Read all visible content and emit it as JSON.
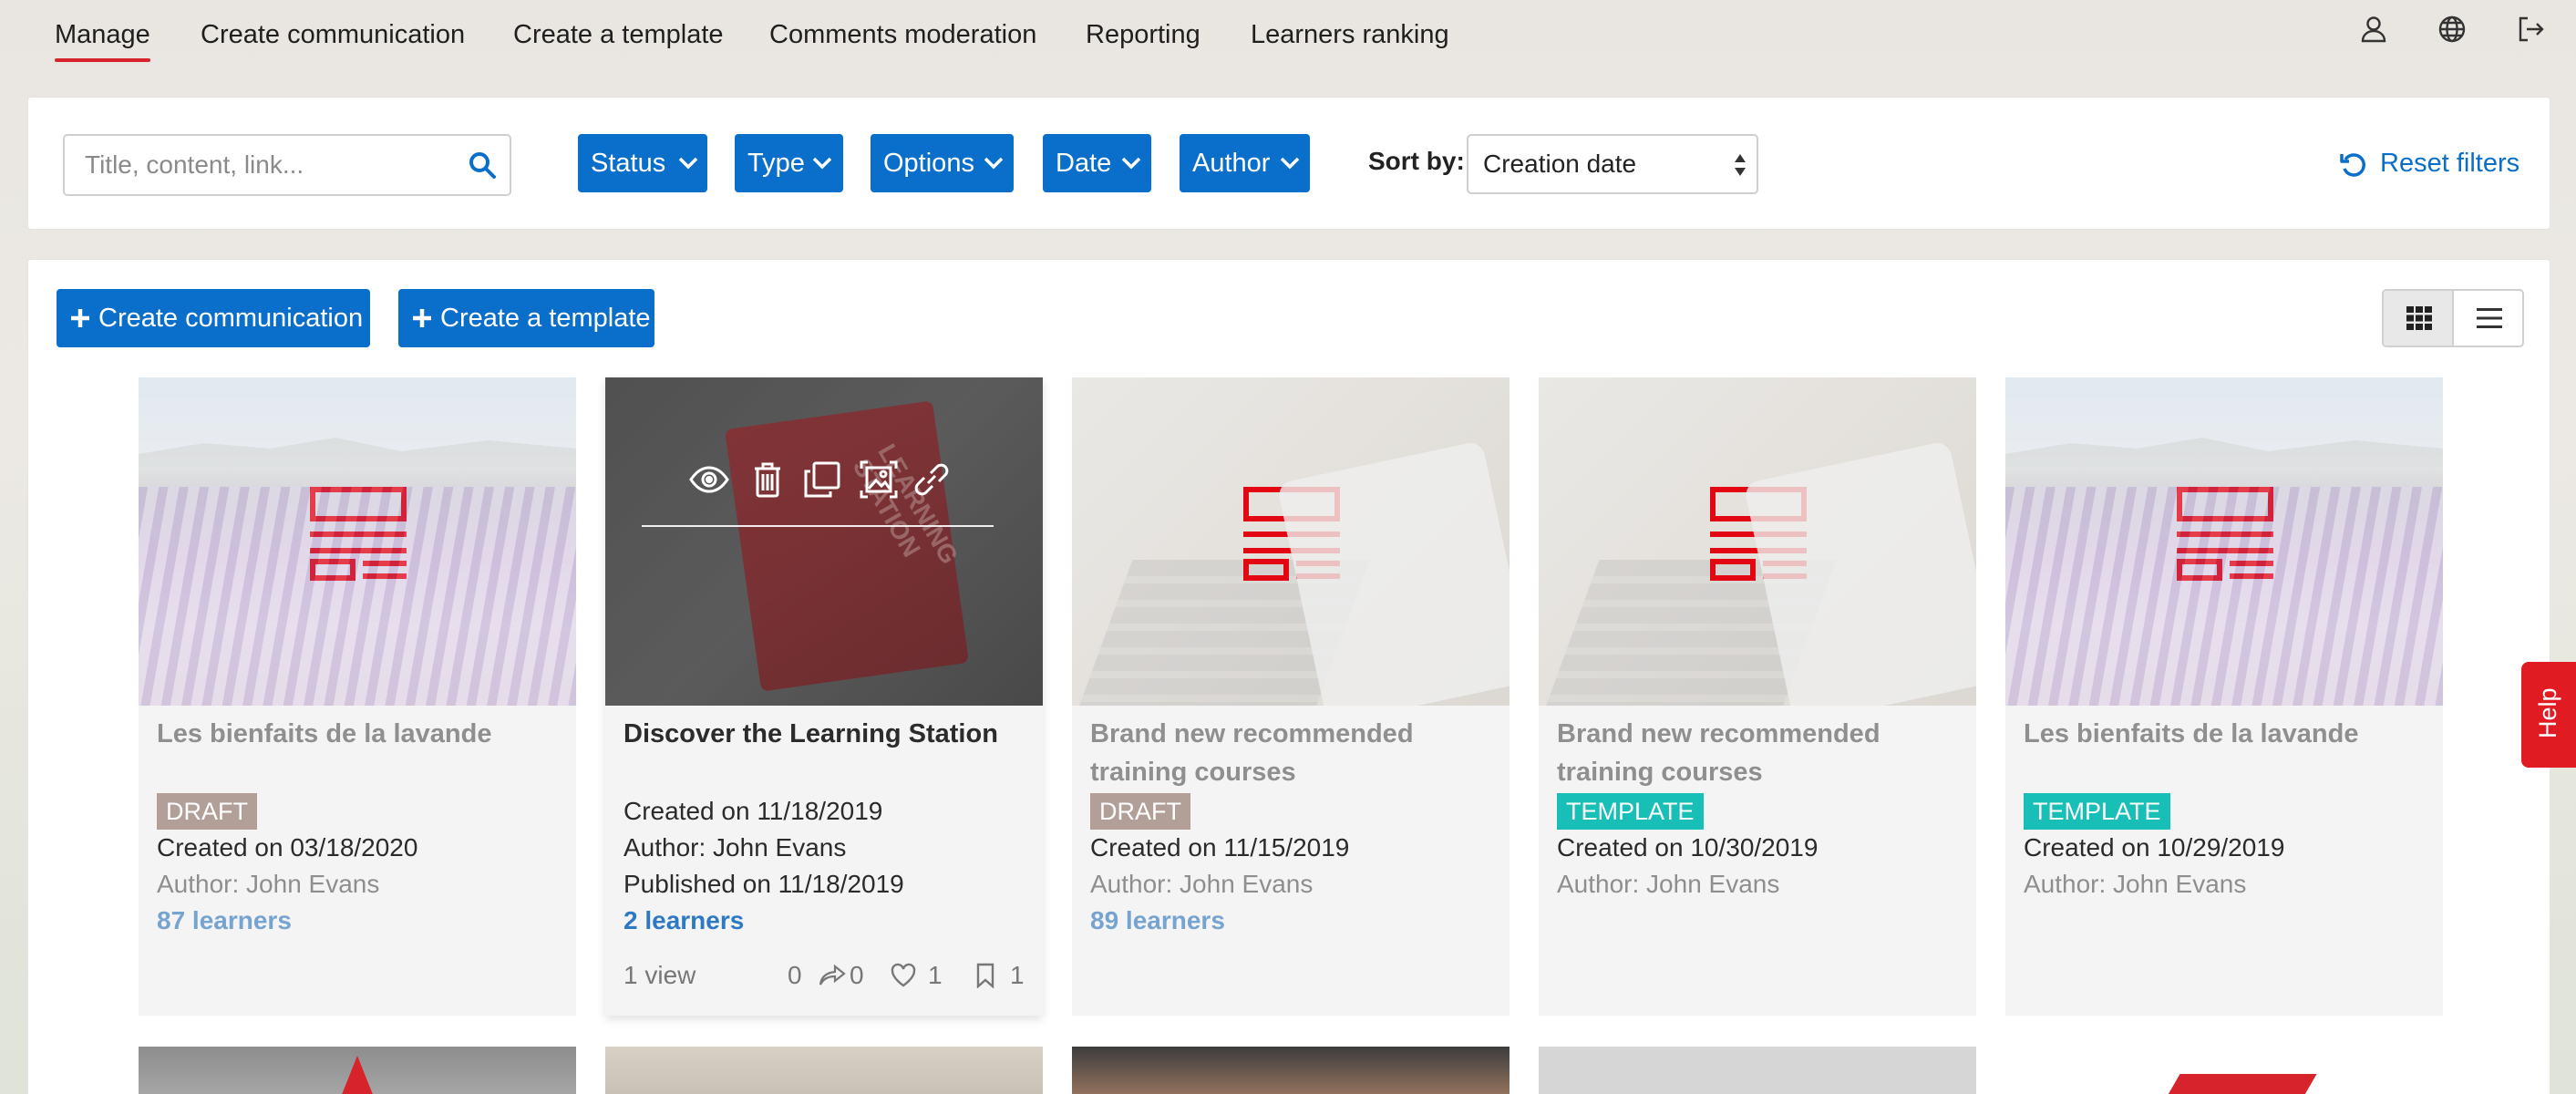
{
  "nav": {
    "tabs": [
      "Manage",
      "Create communication",
      "Create a template",
      "Comments moderation",
      "Reporting",
      "Learners ranking"
    ],
    "active_tab": "Manage",
    "icons": [
      "user-icon",
      "globe-icon",
      "logout-icon"
    ]
  },
  "filters": {
    "search_placeholder": "Title, content, link...",
    "buttons": [
      "Status",
      "Type",
      "Options",
      "Date",
      "Author"
    ],
    "sort_label": "Sort by:",
    "sort_value": "Creation date",
    "reset_label": "Reset filters"
  },
  "actions": {
    "create_communication": "Create communication",
    "create_template": "Create a template"
  },
  "cards": [
    {
      "title": "Les bienfaits de la lavande",
      "badge": "DRAFT",
      "created": "Created on 03/18/2020",
      "author": "Author: John Evans",
      "learners": "87 learners"
    },
    {
      "title": "Discover the Learning Station",
      "created": "Created on 11/18/2019",
      "author": "Author: John Evans",
      "published": "Published on 11/18/2019",
      "learners": "2 learners",
      "views": "1 view",
      "comments": "0",
      "shares": "0",
      "likes": "1",
      "bookmarks": "1"
    },
    {
      "title": "Brand new recommended training courses",
      "badge": "DRAFT",
      "created": "Created on 11/15/2019",
      "author": "Author: John Evans",
      "learners": "89 learners"
    },
    {
      "title": "Brand new recommended training courses",
      "badge": "TEMPLATE",
      "created": "Created on 10/30/2019",
      "author": "Author: John Evans"
    },
    {
      "title": "Les bienfaits de la lavande",
      "badge": "TEMPLATE",
      "created": "Created on 10/29/2019",
      "author": "Author: John Evans"
    }
  ],
  "help_label": "Help",
  "colors": {
    "primary": "#0a6fca",
    "accent_red": "#d7232b",
    "draft_badge": "#b2a098",
    "template_badge": "#18bfb6",
    "learners_link": "#2e79c3"
  }
}
